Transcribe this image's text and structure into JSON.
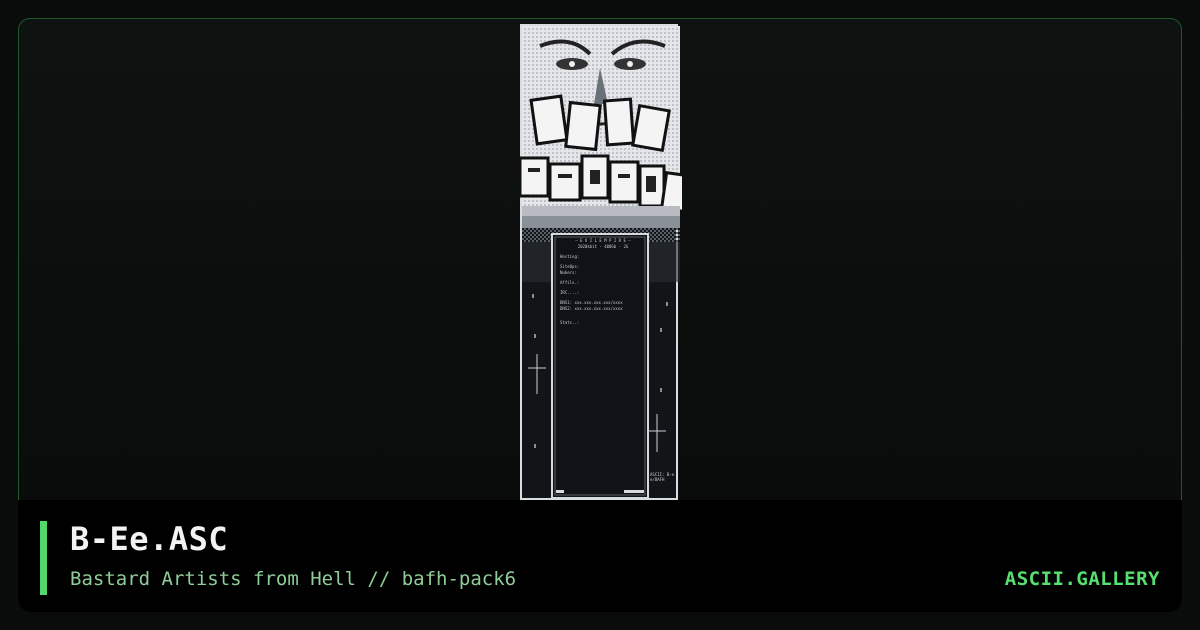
{
  "artwork": {
    "title": "B-Ee.ASC",
    "group_pack": "Bastard Artists from Hell // bafh-pack6"
  },
  "brand": "ASCII.GALLERY",
  "art_text": {
    "header": "— E V I L  E M P I R E —",
    "line_speed": "2020kbit - 400Gb - 2G",
    "hosting": "Hosting:",
    "sitedps": "SiteOps:",
    "nukers": "Nukers:",
    "affils": "Affils.:",
    "irc": "IRC....:",
    "dns1": "DNS1: xxx.xxx.xxx.xxx/xxxx",
    "dns2": "DNS2: xxx.xxx.xxx.xxx/xxxx",
    "stats": "Stats..:",
    "signature": "ASCII: B-ee/BAFH"
  },
  "colors": {
    "accent": "#53d86a",
    "border": "#1f5a2a",
    "footer_bg": "#000000"
  }
}
